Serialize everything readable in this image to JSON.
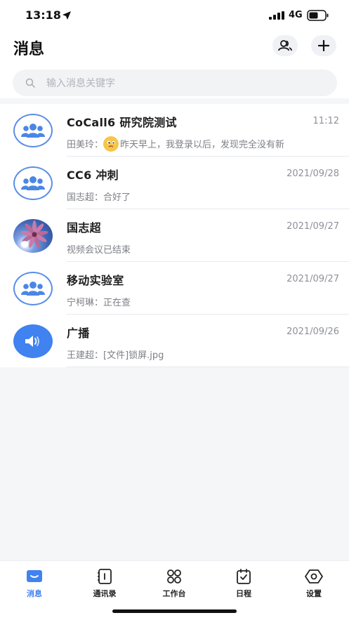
{
  "status_bar": {
    "time": "13:18",
    "network": "4G"
  },
  "header": {
    "title": "消息",
    "search_placeholder": "输入消息关键字"
  },
  "messages": [
    {
      "title": "CoCall6 研究院测试",
      "time": "11:12",
      "sender": "田美玲：",
      "preview": "昨天早上，我登录以后，发现完全没有新",
      "avatar": "group-icon",
      "has_emoji": true
    },
    {
      "title": "CC6 冲刺",
      "time": "2021/09/28",
      "preview": "国志超：合好了",
      "avatar": "group-icon"
    },
    {
      "title": "国志超",
      "time": "2021/09/27",
      "preview": "视频会议已结束",
      "avatar": "photo"
    },
    {
      "title": "移动实验室",
      "time": "2021/09/27",
      "preview": "宁柯琳：正在查",
      "avatar": "group-icon"
    },
    {
      "title": "广播",
      "time": "2021/09/26",
      "preview": "王建超：[文件]锁屏.jpg",
      "avatar": "speaker-icon"
    }
  ],
  "tabbar": {
    "items": [
      {
        "label": "消息",
        "icon": "message-icon",
        "active": true
      },
      {
        "label": "通讯录",
        "icon": "address-book-icon",
        "active": false
      },
      {
        "label": "工作台",
        "icon": "workbench-icon",
        "active": false
      },
      {
        "label": "日程",
        "icon": "calendar-icon",
        "active": false
      },
      {
        "label": "设置",
        "icon": "settings-icon",
        "active": false
      }
    ]
  },
  "colors": {
    "accent": "#3f82f0",
    "group_border": "#5a8ee6",
    "background": "#f5f6f8"
  }
}
